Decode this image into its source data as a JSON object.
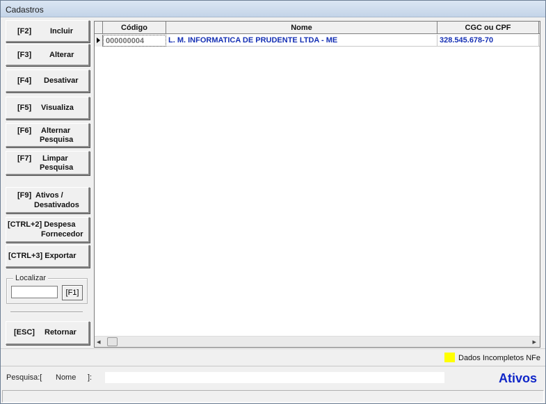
{
  "window": {
    "title": "Cadastros"
  },
  "buttons": {
    "incluir": {
      "key": "[F2]",
      "label": "Incluir"
    },
    "alterar": {
      "key": "[F3]",
      "label": "Alterar"
    },
    "desativar": {
      "key": "[F4]",
      "label": "Desativar"
    },
    "visualiza": {
      "key": "[F5]",
      "label": "Visualiza"
    },
    "alternar": {
      "key": "[F6]",
      "label1": "Alternar",
      "label2": "Pesquisa"
    },
    "limpar": {
      "key": "[F7]",
      "label1": "Limpar",
      "label2": "Pesquisa"
    },
    "ativos": {
      "key": "[F9]",
      "label1": "Ativos /",
      "label2": "Desativados"
    },
    "despesa": {
      "line1": "[CTRL+2] Despesa",
      "line2": "Fornecedor"
    },
    "exportar": {
      "label": "[CTRL+3] Exportar"
    },
    "retornar": {
      "key": "[ESC]",
      "label": "Retornar"
    }
  },
  "localizar": {
    "label": "Localizar",
    "value": "",
    "button": "[F1]"
  },
  "grid": {
    "columns": [
      "Código",
      "Nome",
      "CGC ou CPF"
    ],
    "rows": [
      {
        "codigo": "000000004",
        "nome": "L. M. INFORMATICA DE PRUDENTE LTDA - ME",
        "cpf": "328.545.678-70"
      }
    ],
    "scroll_left": "◂",
    "scroll_right": "▸"
  },
  "legend": {
    "label": "Dados Incompletos NFe",
    "color": "#ffff00"
  },
  "pesquisa": {
    "prefix": "Pesquisa:[",
    "field": "Nome",
    "suffix": "]:",
    "value": ""
  },
  "status": {
    "label": "Ativos",
    "color": "#0f26c8"
  },
  "colors": {
    "row_text": "#1530b4",
    "code_text": "#707070"
  }
}
